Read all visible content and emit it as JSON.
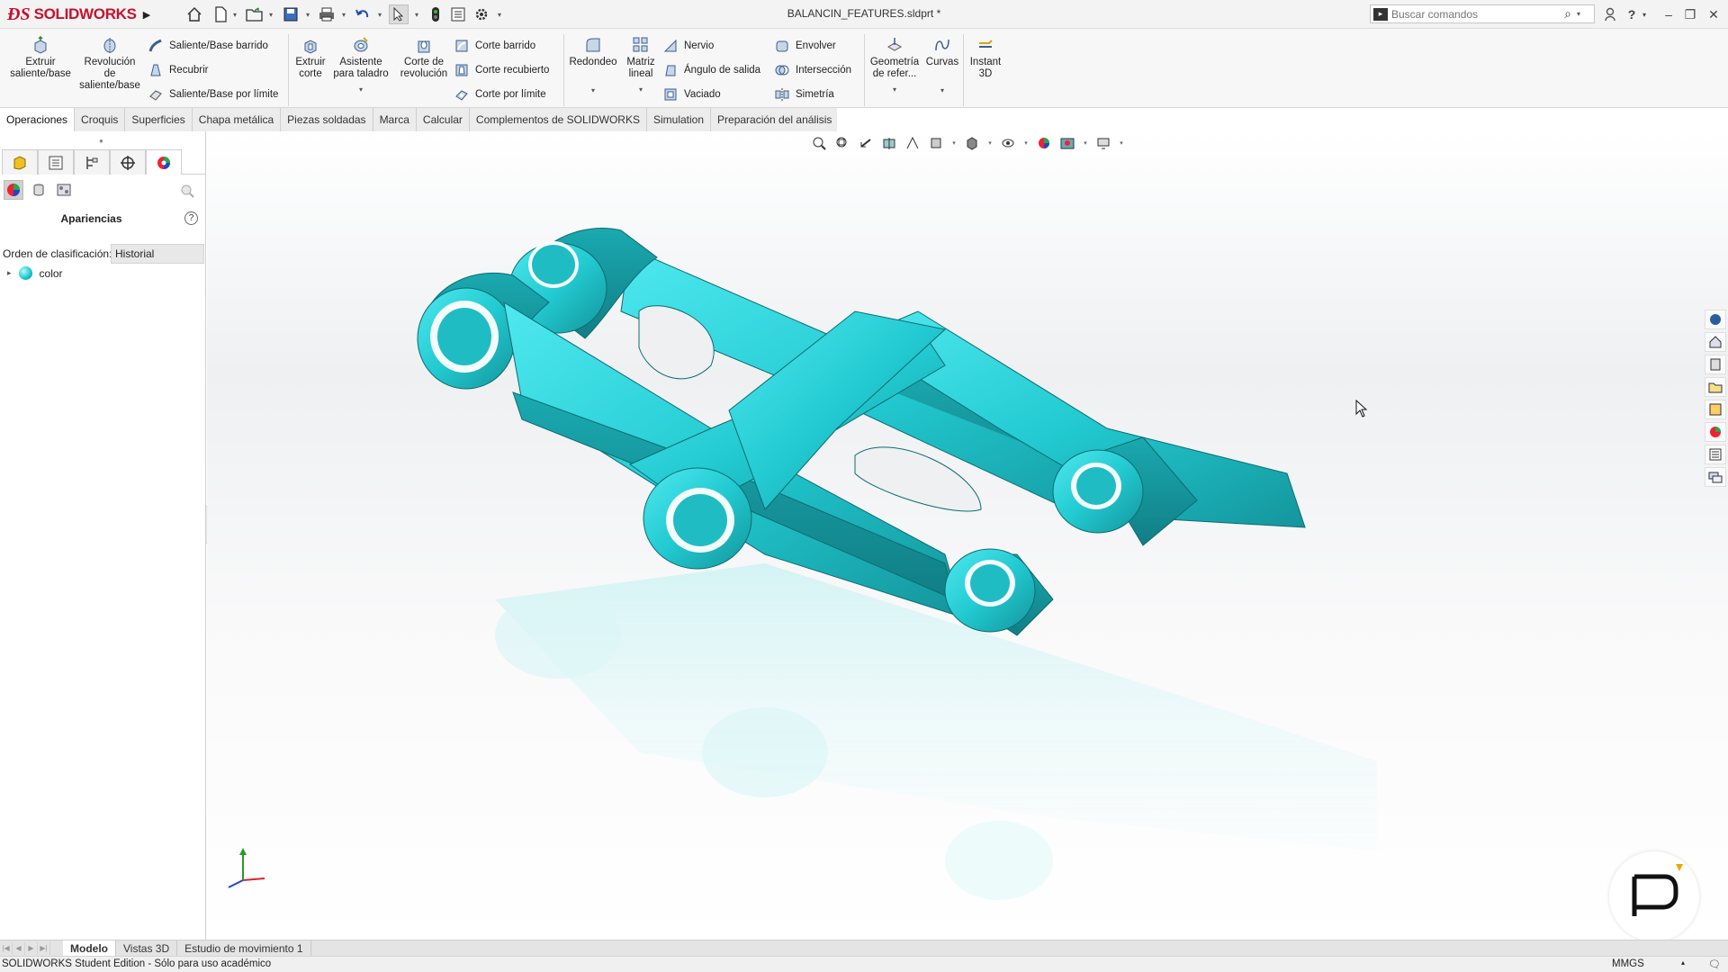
{
  "app": {
    "logo_brand": "SOLIDWORKS",
    "doc_title": "BALANCIN_FEATURES.sldprt *"
  },
  "quick_access": [
    {
      "icon": "home-icon"
    },
    {
      "icon": "new-document-icon"
    },
    {
      "icon": "open-folder-icon"
    },
    {
      "icon": "save-icon"
    },
    {
      "icon": "print-icon"
    },
    {
      "icon": "undo-icon"
    },
    {
      "icon": "select-pointer-icon"
    },
    {
      "icon": "rebuild-icon"
    },
    {
      "icon": "file-properties-icon"
    },
    {
      "icon": "options-gear-icon"
    }
  ],
  "search": {
    "placeholder": "Buscar comandos"
  },
  "ribbon": {
    "extrude_boss": "Extruir saliente/base",
    "revolve_boss": "Revolución de saliente/base",
    "swept_boss": "Saliente/Base barrido",
    "loft_boss": "Recubrir",
    "boundary_boss": "Saliente/Base por límite",
    "extrude_cut": "Extruir corte",
    "hole_wizard": "Asistente para taladro",
    "revolve_cut": "Corte de revolución",
    "swept_cut": "Corte barrido",
    "loft_cut": "Corte recubierto",
    "boundary_cut": "Corte por límite",
    "fillet": "Redondeo",
    "linear_pattern": "Matriz lineal",
    "rib": "Nervio",
    "draft": "Ángulo de salida",
    "shell": "Vaciado",
    "wrap": "Envolver",
    "intersect": "Intersección",
    "mirror": "Simetría",
    "ref_geometry": "Geometría de refer...",
    "curves": "Curvas",
    "instant3d": "Instant 3D"
  },
  "tabs": [
    "Operaciones",
    "Croquis",
    "Superficies",
    "Chapa metálica",
    "Piezas soldadas",
    "Marca",
    "Calcular",
    "Complementos de SOLIDWORKS",
    "Simulation",
    "Preparación del análisis"
  ],
  "active_tab": "Operaciones",
  "panel": {
    "title": "Apariencias",
    "sort_label": "Orden de clasificación:",
    "sort_value": "Historial",
    "tree_item": "color"
  },
  "bottom_tabs": [
    "Modelo",
    "Vistas 3D",
    "Estudio de movimiento 1"
  ],
  "active_bottom_tab": "Modelo",
  "status": {
    "edition": "SOLIDWORKS Student Edition - Sólo para uso académico",
    "units": "MMGS"
  },
  "colors": {
    "model": "#1fc8cf",
    "model_shadow": "#148f96",
    "brand": "#c8102e"
  }
}
